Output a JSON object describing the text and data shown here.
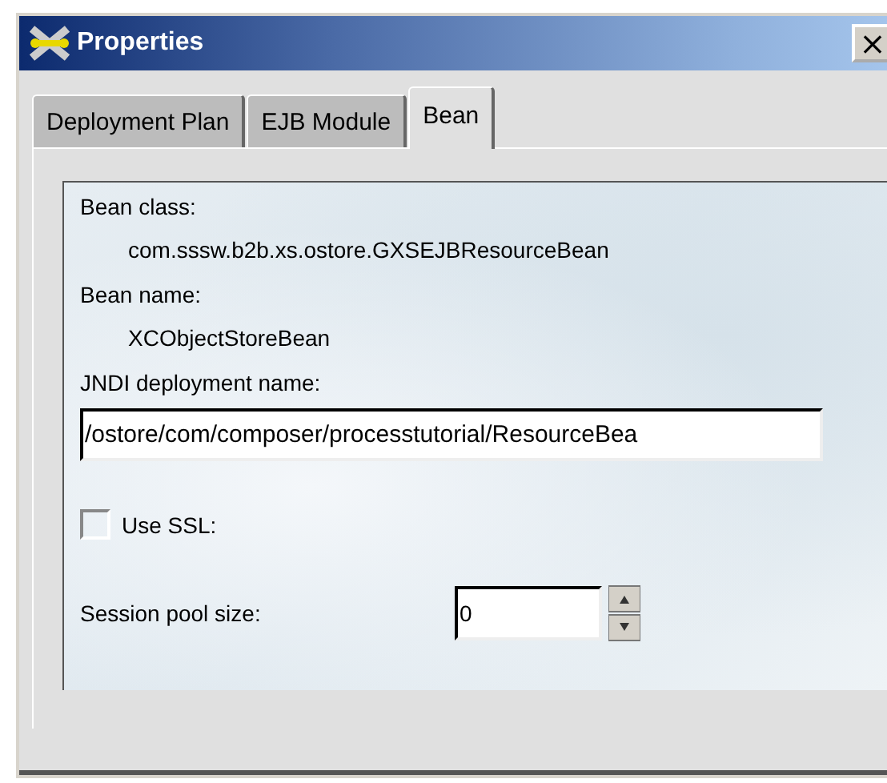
{
  "window": {
    "title": "Properties",
    "close": "×"
  },
  "tabs": [
    {
      "label": "Deployment Plan",
      "selected": false
    },
    {
      "label": "EJB Module",
      "selected": false
    },
    {
      "label": "Bean",
      "selected": true
    }
  ],
  "bean_class": {
    "label": "Bean class:",
    "value": "com.sssw.b2b.xs.ostore.GXSEJBResourceBean"
  },
  "bean_name": {
    "label": "Bean name:",
    "value": "XCObjectStoreBean"
  },
  "jndi": {
    "label": "JNDI deployment name:",
    "value": "/ostore/com/composer/processtutorial/ResourceBea"
  },
  "use_ssl": {
    "label": "Use SSL:",
    "checked": false
  },
  "session_pool": {
    "label": "Session pool size:",
    "value": "0"
  }
}
